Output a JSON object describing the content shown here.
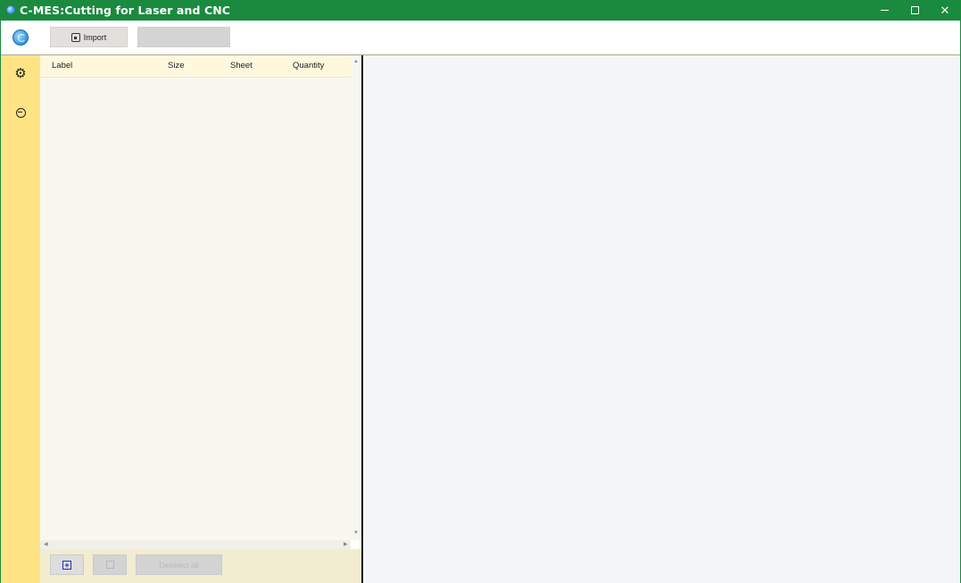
{
  "window": {
    "title": "C-MES:Cutting for Laser and CNC",
    "controls": {
      "minimize": "–",
      "maximize": "□",
      "close": "✕"
    }
  },
  "toolbar": {
    "import_label": "Import",
    "disabled_button_label": ""
  },
  "sidebar": {
    "items": [
      {
        "icon": "gear-icon",
        "glyph": "⚙"
      },
      {
        "icon": "minus-circle-icon"
      }
    ]
  },
  "table": {
    "columns": [
      "Label",
      "Size",
      "Sheet",
      "Quantity"
    ],
    "rows": []
  },
  "footer": {
    "add_glyph": "+",
    "deselect_all_label": "Deselect all"
  },
  "colors": {
    "titlebar": "#1a8a3e",
    "sidebar": "#fee485",
    "panel_background": "#f9f8ef",
    "table_header": "#fff8dd",
    "canvas": "#f4f5f7"
  }
}
